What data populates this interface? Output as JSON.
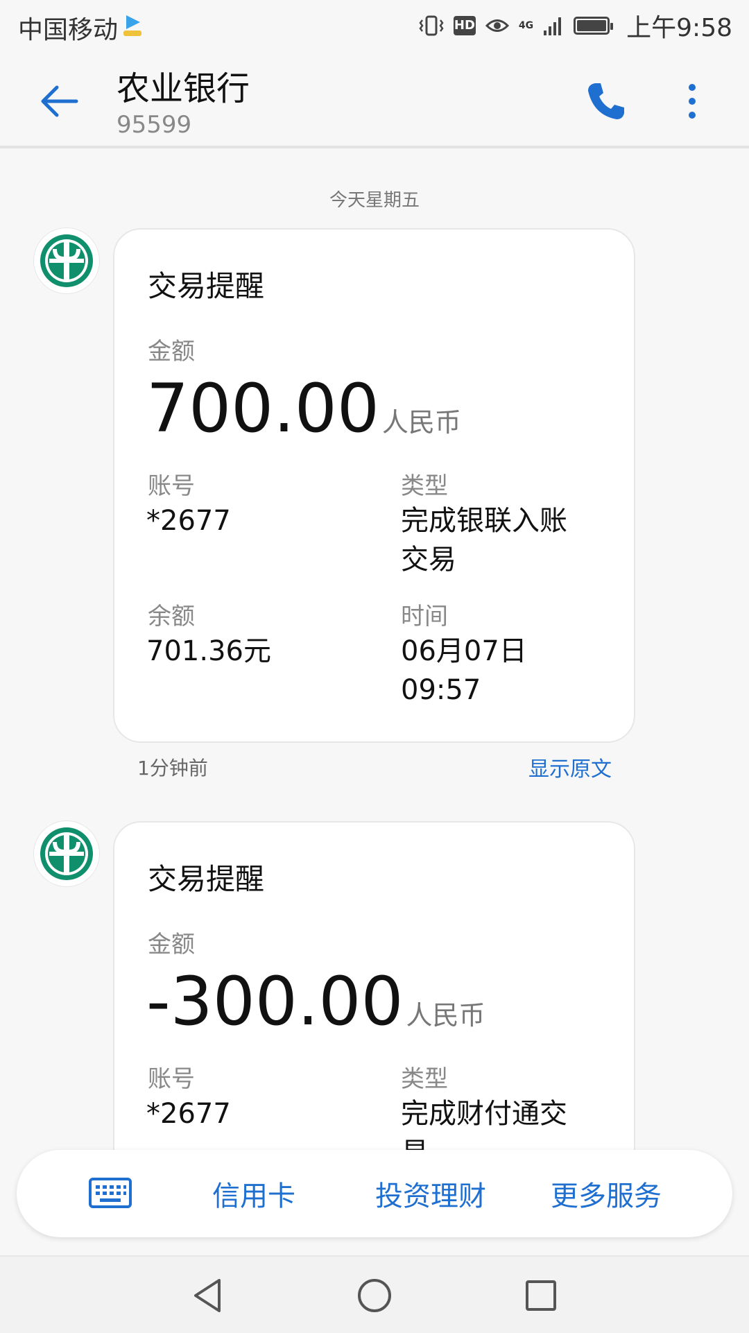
{
  "status_bar": {
    "carrier": "中国移动",
    "hd": "HD",
    "network": "4G",
    "time": "上午9:58"
  },
  "header": {
    "title": "农业银行",
    "number": "95599"
  },
  "date_divider": "今天星期五",
  "messages": [
    {
      "title": "交易提醒",
      "amount_label": "金额",
      "amount": "700.00",
      "currency": "人民币",
      "account_label": "账号",
      "account": "*2677",
      "type_label": "类型",
      "type_line1": "完成银联入账",
      "type_line2": "交易",
      "balance_label": "余额",
      "balance": "701.36元",
      "time_label": "时间",
      "time_line1": "06月07日",
      "time_line2": "09:57",
      "sent": "1分钟前",
      "show_original": "显示原文"
    },
    {
      "title": "交易提醒",
      "amount_label": "金额",
      "amount": "-300.00",
      "currency": "人民币",
      "account_label": "账号",
      "account": "*2677",
      "type_label": "类型",
      "type_line1": "完成财付通交",
      "type_line2": "易"
    }
  ],
  "actions": {
    "credit_card": "信用卡",
    "investment": "投资理财",
    "more_services": "更多服务"
  },
  "colors": {
    "accent": "#1f6fd1",
    "abc_green": "#0f8f6b"
  }
}
